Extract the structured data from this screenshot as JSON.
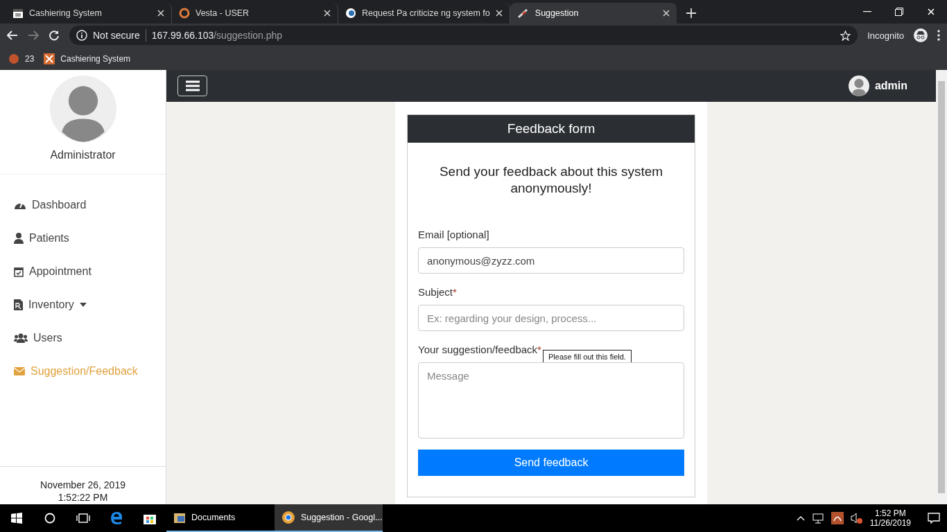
{
  "browser": {
    "tabs": [
      {
        "title": "Cashiering System",
        "selected": false
      },
      {
        "title": "Vesta - USER",
        "selected": false
      },
      {
        "title": "Request Pa criticize ng system fo",
        "selected": false
      },
      {
        "title": "Suggestion",
        "selected": true
      }
    ],
    "security": "Not secure",
    "url_host": "167.99.66.103",
    "url_path": "/suggestion.php",
    "profile": "Incognito",
    "bookmarks": [
      {
        "label": "23"
      },
      {
        "label": "Cashiering System"
      }
    ]
  },
  "sidebar": {
    "user": "Administrator",
    "items": [
      {
        "label": "Dashboard",
        "selected": false,
        "dropdown": false
      },
      {
        "label": "Patients",
        "selected": false,
        "dropdown": false
      },
      {
        "label": "Appointment",
        "selected": false,
        "dropdown": false
      },
      {
        "label": "Inventory",
        "selected": false,
        "dropdown": true
      },
      {
        "label": "Users",
        "selected": false,
        "dropdown": false
      },
      {
        "label": "Suggestion/Feedback",
        "selected": true,
        "dropdown": false
      }
    ],
    "date": "November 26, 2019",
    "time": "1:52:22 PM"
  },
  "topbar": {
    "user": "admin"
  },
  "form": {
    "title": "Feedback form",
    "heading": "Send your feedback about this system anonymously!",
    "fields": [
      {
        "kind": "input",
        "label": "Email [optional]",
        "required": false,
        "value": "anonymous@zyzz.com"
      },
      {
        "kind": "input",
        "label": "Subject",
        "required": true,
        "placeholder": "Ex: regarding your design, process...",
        "tooltip": "Please fill out this field."
      },
      {
        "kind": "textarea",
        "label": "Your suggestion/feedback",
        "required": true,
        "placeholder": "Message"
      }
    ],
    "required_mark": "*",
    "submit": "Send feedback"
  },
  "taskbar": {
    "apps": [
      {
        "label": "Documents",
        "selected": false
      },
      {
        "label": "Suggestion - Googl...",
        "selected": true
      }
    ],
    "time": "1:52 PM",
    "date": "11/26/2019"
  }
}
